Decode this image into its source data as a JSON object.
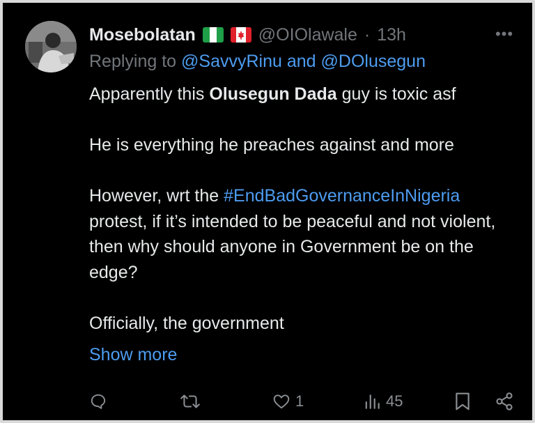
{
  "tweet": {
    "author": {
      "display_name": "Mosebolatan",
      "flags": [
        "nigeria-flag",
        "canada-flag"
      ],
      "handle": "@OIOlawale",
      "separator": "·",
      "time": "13h"
    },
    "more_icon": "more-horizontal-icon",
    "reply_context": {
      "prefix": "Replying to ",
      "user1": "@SavvyRinu",
      "conjunction": " and ",
      "user2": "@DOlusegun"
    },
    "body": {
      "line1_pre": "Apparently this ",
      "line1_bold": "Olusegun Dada",
      "line1_post": " guy is toxic asf",
      "line2": "He is everything he preaches against and more",
      "line3_pre": "However, wrt the ",
      "line3_hashtag": "#EndBadGovernanceInNigeria",
      "line3_post": " protest, if it’s intended to be peaceful and not violent, then why should anyone in Government be on the edge?",
      "line4": "Officially, the government"
    },
    "show_more": "Show more",
    "actions": {
      "reply_icon": "reply-icon",
      "retweet_icon": "retweet-icon",
      "like_icon": "heart-icon",
      "like_count": "1",
      "views_icon": "views-bar-icon",
      "views_count": "45",
      "bookmark_icon": "bookmark-icon",
      "share_icon": "share-icon"
    },
    "colors": {
      "background": "#000000",
      "text": "#e7e9ea",
      "muted": "#71767b",
      "link": "#4d9cf0"
    }
  }
}
